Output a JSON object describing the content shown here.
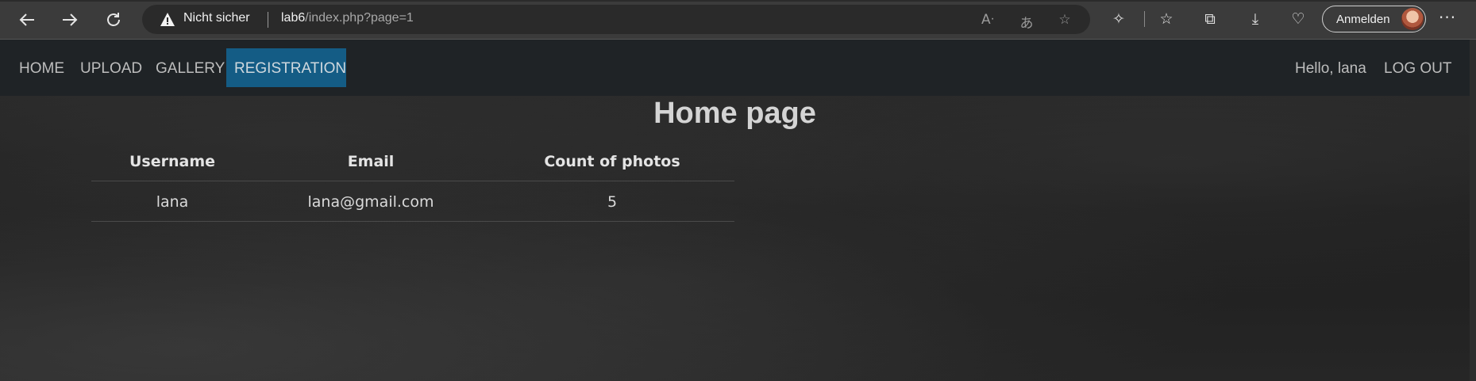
{
  "browser": {
    "security_text": "Nicht sicher",
    "url_host": "lab6",
    "url_path": "/index.php?page=1",
    "signin_label": "Anmelden",
    "icons": [
      "back-icon",
      "forward-icon",
      "refresh-icon",
      "warning-icon",
      "read-aloud-icon",
      "translate-icon",
      "favorite-icon",
      "extensions-icon",
      "favorites-icon",
      "collections-icon",
      "downloads-icon",
      "performance-icon",
      "more-icon"
    ]
  },
  "navbar": {
    "links": [
      {
        "label": "HOME"
      },
      {
        "label": "UPLOAD"
      },
      {
        "label": "GALLERY"
      },
      {
        "label": "REGISTRATION",
        "active": true
      }
    ],
    "greeting": "Hello, lana",
    "logout": "LOG OUT",
    "active_color": "#145c85"
  },
  "main": {
    "title": "Home page",
    "table": {
      "headers": [
        "Username",
        "Email",
        "Count of photos"
      ],
      "rows": [
        [
          "lana",
          "lana@gmail.com",
          "5"
        ]
      ]
    }
  }
}
